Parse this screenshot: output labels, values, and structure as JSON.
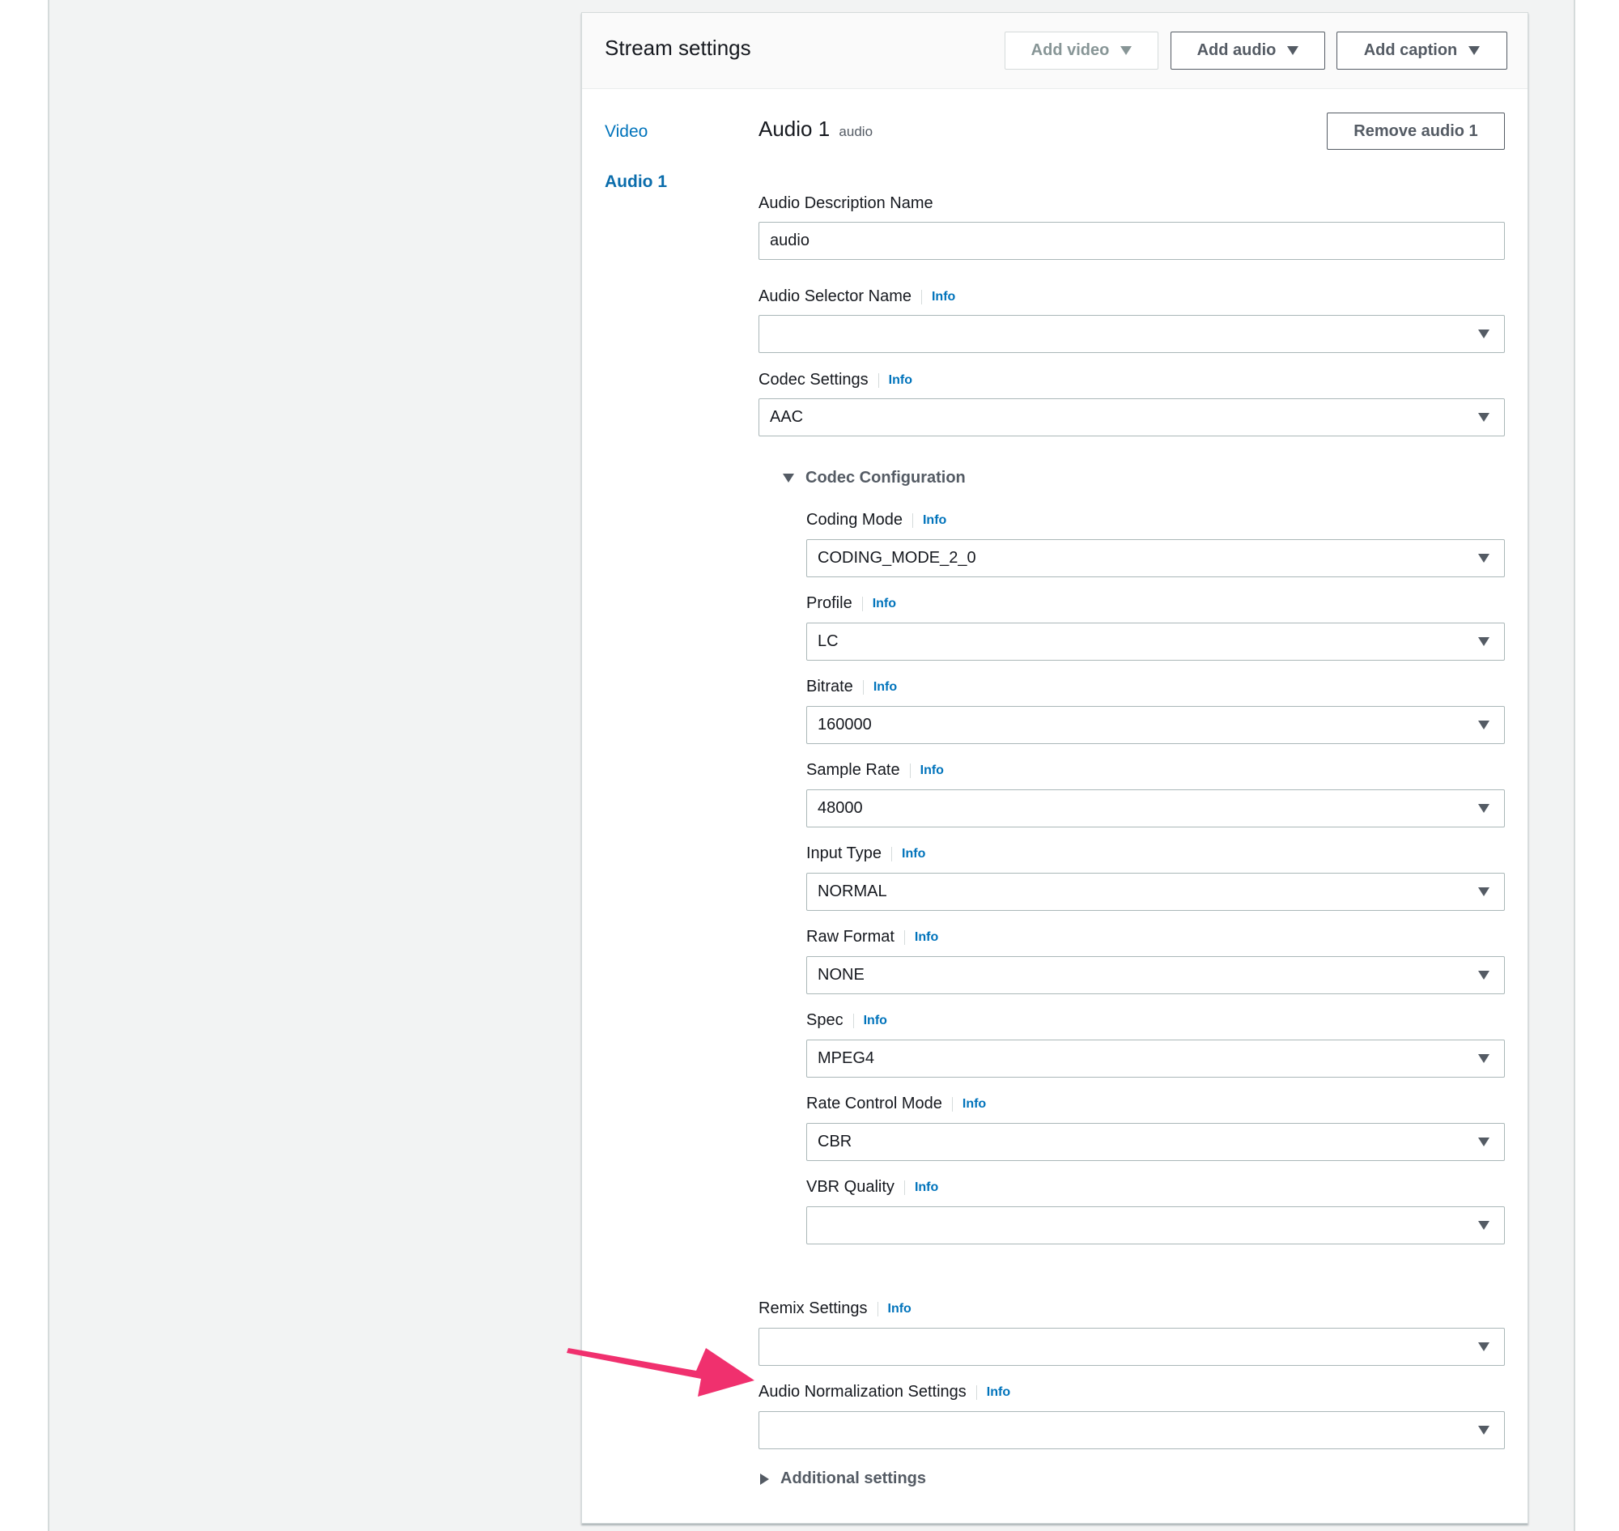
{
  "panel": {
    "title": "Stream settings",
    "buttons": {
      "add_video": "Add video",
      "add_audio": "Add audio",
      "add_caption": "Add caption"
    }
  },
  "nav": {
    "video": "Video",
    "audio1": "Audio 1"
  },
  "section": {
    "title": "Audio 1",
    "subtitle": "audio",
    "remove_button": "Remove audio 1"
  },
  "info_label": "Info",
  "fields": {
    "audio_description_name": {
      "label": "Audio Description Name",
      "value": "audio"
    },
    "audio_selector_name": {
      "label": "Audio Selector Name",
      "value": ""
    },
    "codec_settings": {
      "label": "Codec Settings",
      "value": "AAC"
    },
    "codec_configuration": "Codec Configuration",
    "coding_mode": {
      "label": "Coding Mode",
      "value": "CODING_MODE_2_0"
    },
    "profile": {
      "label": "Profile",
      "value": "LC"
    },
    "bitrate": {
      "label": "Bitrate",
      "value": "160000"
    },
    "sample_rate": {
      "label": "Sample Rate",
      "value": "48000"
    },
    "input_type": {
      "label": "Input Type",
      "value": "NORMAL"
    },
    "raw_format": {
      "label": "Raw Format",
      "value": "NONE"
    },
    "spec": {
      "label": "Spec",
      "value": "MPEG4"
    },
    "rate_control_mode": {
      "label": "Rate Control Mode",
      "value": "CBR"
    },
    "vbr_quality": {
      "label": "VBR Quality",
      "value": ""
    },
    "remix_settings": {
      "label": "Remix Settings",
      "value": ""
    },
    "audio_normalization_settings": {
      "label": "Audio Normalization Settings",
      "value": ""
    },
    "additional_settings": "Additional settings"
  },
  "colors": {
    "accent_link": "#0073bb",
    "annotation_arrow": "#f0306e"
  }
}
